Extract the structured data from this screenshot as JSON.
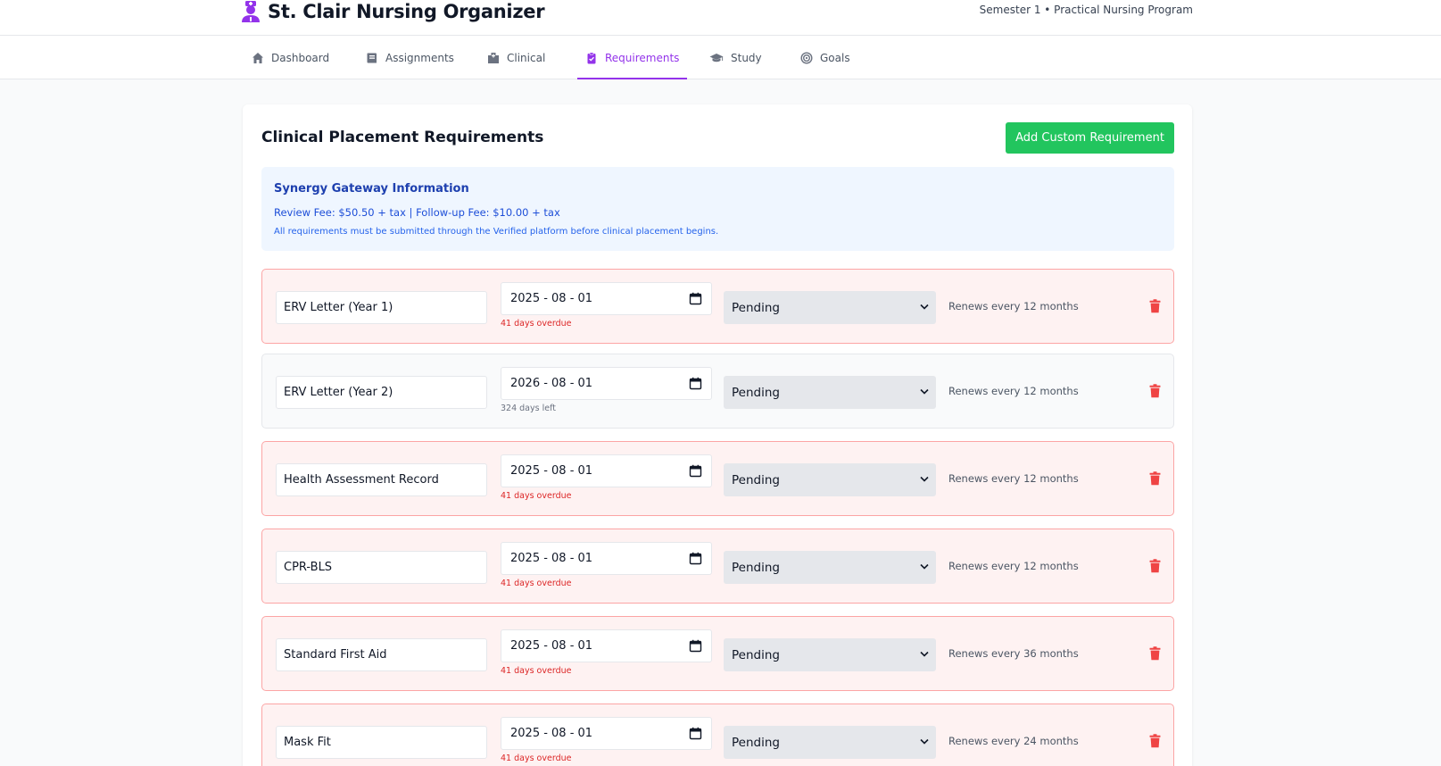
{
  "app": {
    "title": "St. Clair Nursing Organizer",
    "subtitle": "Semester 1 • Practical Nursing Program",
    "accent_color": "#9333ea",
    "brand_icon": "nurse-icon"
  },
  "nav": {
    "active": "Requirements",
    "tabs": [
      {
        "label": "Dashboard",
        "icon": "home-icon"
      },
      {
        "label": "Assignments",
        "icon": "book-icon"
      },
      {
        "label": "Clinical",
        "icon": "hospital-icon"
      },
      {
        "label": "Requirements",
        "icon": "clipboard-check-icon"
      },
      {
        "label": "Study",
        "icon": "graduation-cap-icon"
      },
      {
        "label": "Goals",
        "icon": "target-icon"
      }
    ]
  },
  "page": {
    "title": "Clinical Placement Requirements",
    "add_button": "Add Custom Requirement",
    "add_button_color": "#22c55e"
  },
  "info": {
    "title": "Synergy Gateway Information",
    "fees": "Review Fee: $50.50 + tax | Follow-up Fee: $10.00 + tax",
    "note": "All requirements must be submitted through the Verified platform before clinical placement begins."
  },
  "requirements": [
    {
      "name": "ERV Letter (Year 1)",
      "date": "2025 - 08 - 01",
      "due": "41 days overdue",
      "overdue": true,
      "status": "Pending",
      "renew": "Renews every 12 months"
    },
    {
      "name": "ERV Letter (Year 2)",
      "date": "2026 - 08 - 01",
      "due": "324 days left",
      "overdue": false,
      "status": "Pending",
      "renew": "Renews every 12 months"
    },
    {
      "name": "Health Assessment Record",
      "date": "2025 - 08 - 01",
      "due": "41 days overdue",
      "overdue": true,
      "status": "Pending",
      "renew": "Renews every 12 months"
    },
    {
      "name": "CPR-BLS",
      "date": "2025 - 08 - 01",
      "due": "41 days overdue",
      "overdue": true,
      "status": "Pending",
      "renew": "Renews every 12 months"
    },
    {
      "name": "Standard First Aid",
      "date": "2025 - 08 - 01",
      "due": "41 days overdue",
      "overdue": true,
      "status": "Pending",
      "renew": "Renews every 36 months"
    },
    {
      "name": "Mask Fit",
      "date": "2025 - 08 - 01",
      "due": "41 days overdue",
      "overdue": true,
      "status": "Pending",
      "renew": "Renews every 24 months"
    }
  ],
  "colors": {
    "overdue_text": "#dc2626",
    "overdue_bg": "#fef2f2",
    "overdue_border": "#fca5a5",
    "trash": "#ef4444"
  }
}
